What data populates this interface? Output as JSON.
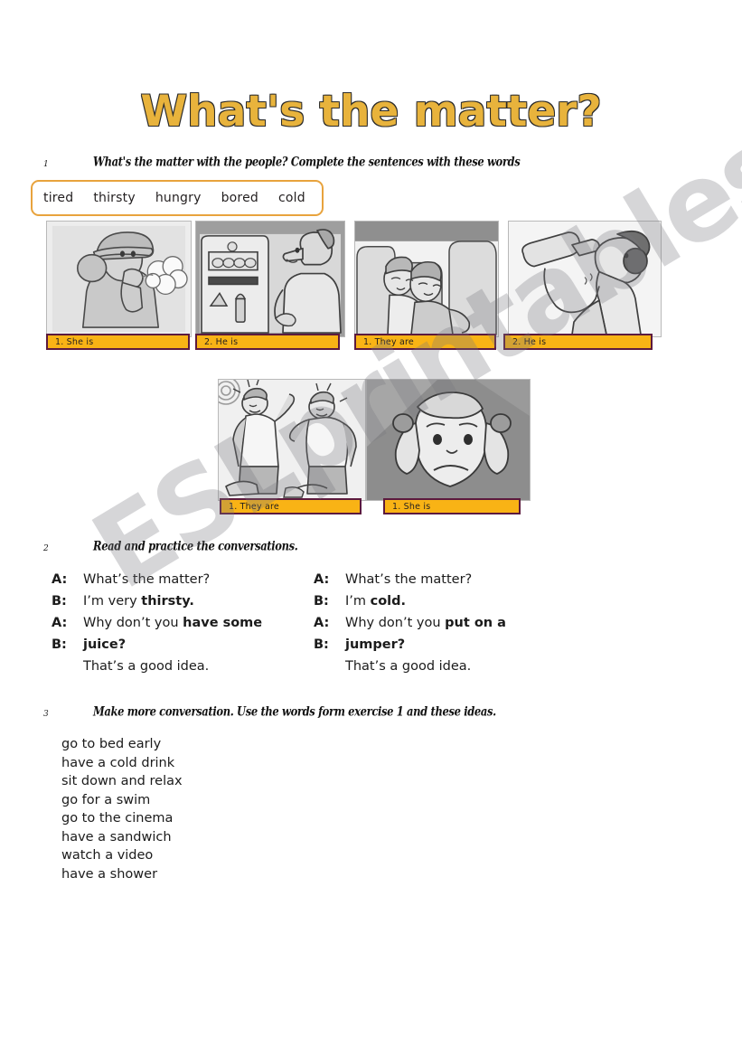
{
  "title": "What's the matter?",
  "watermark": "ESLprintables.com",
  "colors": {
    "title_fill": "#e8b33c",
    "title_stroke": "#2b2b2b",
    "wordbank_border": "#e8a33d",
    "answer_bar_fill": "#f9b315",
    "answer_bar_border": "#5c1a3e"
  },
  "exercise1": {
    "number": "1",
    "instruction": "What's the matter with the people? Complete the sentences with these words",
    "wordbank": [
      "tired",
      "thirsty",
      "hungry",
      "bored",
      "cold"
    ],
    "pictures": [
      {
        "alt": "woman-in-hat-blowing-on-hands",
        "answer": "1. She is"
      },
      {
        "alt": "man-looking-in-fridge",
        "answer": "2. He is"
      },
      {
        "alt": "two-people-sleeping-in-seats",
        "answer": "1. They are"
      },
      {
        "alt": "man-drinking-from-bottle",
        "answer": "2. He is"
      },
      {
        "alt": "two-men-sweating-at-work",
        "answer": "1. They are"
      },
      {
        "alt": "girl-with-pigtails-looking-bored",
        "answer": "1. She is"
      }
    ]
  },
  "exercise2": {
    "number": "2",
    "instruction": "Read and practice the conversations.",
    "conversations": [
      {
        "lines": [
          {
            "speaker": "A:",
            "plain": "What’s the matter?",
            "bold": "",
            "tail": ""
          },
          {
            "speaker": "B:",
            "plain": "I’m very ",
            "bold": "thirsty.",
            "tail": ""
          },
          {
            "speaker": "A:",
            "plain": "Why don’t you ",
            "bold": "have some",
            "tail": ""
          },
          {
            "speaker": "B:",
            "plain": "",
            "bold": "juice?",
            "tail": ""
          },
          {
            "speaker": "",
            "plain": "That’s a good idea.",
            "bold": "",
            "tail": ""
          }
        ]
      },
      {
        "lines": [
          {
            "speaker": "A:",
            "plain": "What’s the matter?",
            "bold": "",
            "tail": ""
          },
          {
            "speaker": "B:",
            "plain": "I’m ",
            "bold": "cold.",
            "tail": ""
          },
          {
            "speaker": "A:",
            "plain": "Why don’t you ",
            "bold": "put on a",
            "tail": ""
          },
          {
            "speaker": "B:",
            "plain": "",
            "bold": "jumper?",
            "tail": ""
          },
          {
            "speaker": "",
            "plain": "That’s a good idea.",
            "bold": "",
            "tail": ""
          }
        ]
      }
    ]
  },
  "exercise3": {
    "number": "3",
    "instruction": "Make more conversation. Use the words form exercise 1 and these ideas.",
    "ideas": [
      "go to bed early",
      "have a cold drink",
      "sit down and relax",
      "go for a swim",
      "go to the cinema",
      "have a sandwich",
      "watch a video",
      "have a shower"
    ]
  }
}
